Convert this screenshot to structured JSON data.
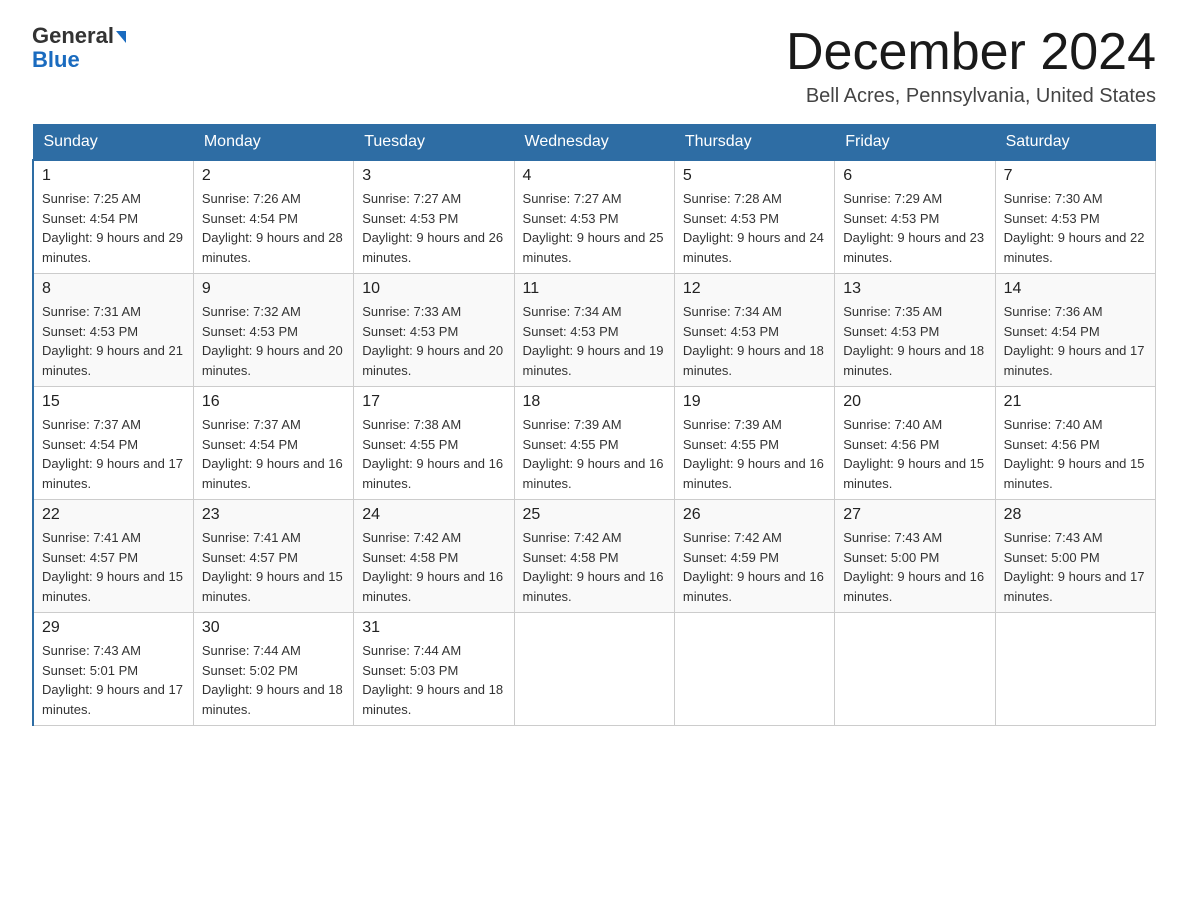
{
  "header": {
    "logo_general": "General",
    "logo_blue": "Blue",
    "month_title": "December 2024",
    "location": "Bell Acres, Pennsylvania, United States"
  },
  "days_of_week": [
    "Sunday",
    "Monday",
    "Tuesday",
    "Wednesday",
    "Thursday",
    "Friday",
    "Saturday"
  ],
  "weeks": [
    [
      {
        "day": "1",
        "sunrise": "7:25 AM",
        "sunset": "4:54 PM",
        "daylight": "9 hours and 29 minutes."
      },
      {
        "day": "2",
        "sunrise": "7:26 AM",
        "sunset": "4:54 PM",
        "daylight": "9 hours and 28 minutes."
      },
      {
        "day": "3",
        "sunrise": "7:27 AM",
        "sunset": "4:53 PM",
        "daylight": "9 hours and 26 minutes."
      },
      {
        "day": "4",
        "sunrise": "7:27 AM",
        "sunset": "4:53 PM",
        "daylight": "9 hours and 25 minutes."
      },
      {
        "day": "5",
        "sunrise": "7:28 AM",
        "sunset": "4:53 PM",
        "daylight": "9 hours and 24 minutes."
      },
      {
        "day": "6",
        "sunrise": "7:29 AM",
        "sunset": "4:53 PM",
        "daylight": "9 hours and 23 minutes."
      },
      {
        "day": "7",
        "sunrise": "7:30 AM",
        "sunset": "4:53 PM",
        "daylight": "9 hours and 22 minutes."
      }
    ],
    [
      {
        "day": "8",
        "sunrise": "7:31 AM",
        "sunset": "4:53 PM",
        "daylight": "9 hours and 21 minutes."
      },
      {
        "day": "9",
        "sunrise": "7:32 AM",
        "sunset": "4:53 PM",
        "daylight": "9 hours and 20 minutes."
      },
      {
        "day": "10",
        "sunrise": "7:33 AM",
        "sunset": "4:53 PM",
        "daylight": "9 hours and 20 minutes."
      },
      {
        "day": "11",
        "sunrise": "7:34 AM",
        "sunset": "4:53 PM",
        "daylight": "9 hours and 19 minutes."
      },
      {
        "day": "12",
        "sunrise": "7:34 AM",
        "sunset": "4:53 PM",
        "daylight": "9 hours and 18 minutes."
      },
      {
        "day": "13",
        "sunrise": "7:35 AM",
        "sunset": "4:53 PM",
        "daylight": "9 hours and 18 minutes."
      },
      {
        "day": "14",
        "sunrise": "7:36 AM",
        "sunset": "4:54 PM",
        "daylight": "9 hours and 17 minutes."
      }
    ],
    [
      {
        "day": "15",
        "sunrise": "7:37 AM",
        "sunset": "4:54 PM",
        "daylight": "9 hours and 17 minutes."
      },
      {
        "day": "16",
        "sunrise": "7:37 AM",
        "sunset": "4:54 PM",
        "daylight": "9 hours and 16 minutes."
      },
      {
        "day": "17",
        "sunrise": "7:38 AM",
        "sunset": "4:55 PM",
        "daylight": "9 hours and 16 minutes."
      },
      {
        "day": "18",
        "sunrise": "7:39 AM",
        "sunset": "4:55 PM",
        "daylight": "9 hours and 16 minutes."
      },
      {
        "day": "19",
        "sunrise": "7:39 AM",
        "sunset": "4:55 PM",
        "daylight": "9 hours and 16 minutes."
      },
      {
        "day": "20",
        "sunrise": "7:40 AM",
        "sunset": "4:56 PM",
        "daylight": "9 hours and 15 minutes."
      },
      {
        "day": "21",
        "sunrise": "7:40 AM",
        "sunset": "4:56 PM",
        "daylight": "9 hours and 15 minutes."
      }
    ],
    [
      {
        "day": "22",
        "sunrise": "7:41 AM",
        "sunset": "4:57 PM",
        "daylight": "9 hours and 15 minutes."
      },
      {
        "day": "23",
        "sunrise": "7:41 AM",
        "sunset": "4:57 PM",
        "daylight": "9 hours and 15 minutes."
      },
      {
        "day": "24",
        "sunrise": "7:42 AM",
        "sunset": "4:58 PM",
        "daylight": "9 hours and 16 minutes."
      },
      {
        "day": "25",
        "sunrise": "7:42 AM",
        "sunset": "4:58 PM",
        "daylight": "9 hours and 16 minutes."
      },
      {
        "day": "26",
        "sunrise": "7:42 AM",
        "sunset": "4:59 PM",
        "daylight": "9 hours and 16 minutes."
      },
      {
        "day": "27",
        "sunrise": "7:43 AM",
        "sunset": "5:00 PM",
        "daylight": "9 hours and 16 minutes."
      },
      {
        "day": "28",
        "sunrise": "7:43 AM",
        "sunset": "5:00 PM",
        "daylight": "9 hours and 17 minutes."
      }
    ],
    [
      {
        "day": "29",
        "sunrise": "7:43 AM",
        "sunset": "5:01 PM",
        "daylight": "9 hours and 17 minutes."
      },
      {
        "day": "30",
        "sunrise": "7:44 AM",
        "sunset": "5:02 PM",
        "daylight": "9 hours and 18 minutes."
      },
      {
        "day": "31",
        "sunrise": "7:44 AM",
        "sunset": "5:03 PM",
        "daylight": "9 hours and 18 minutes."
      },
      null,
      null,
      null,
      null
    ]
  ]
}
